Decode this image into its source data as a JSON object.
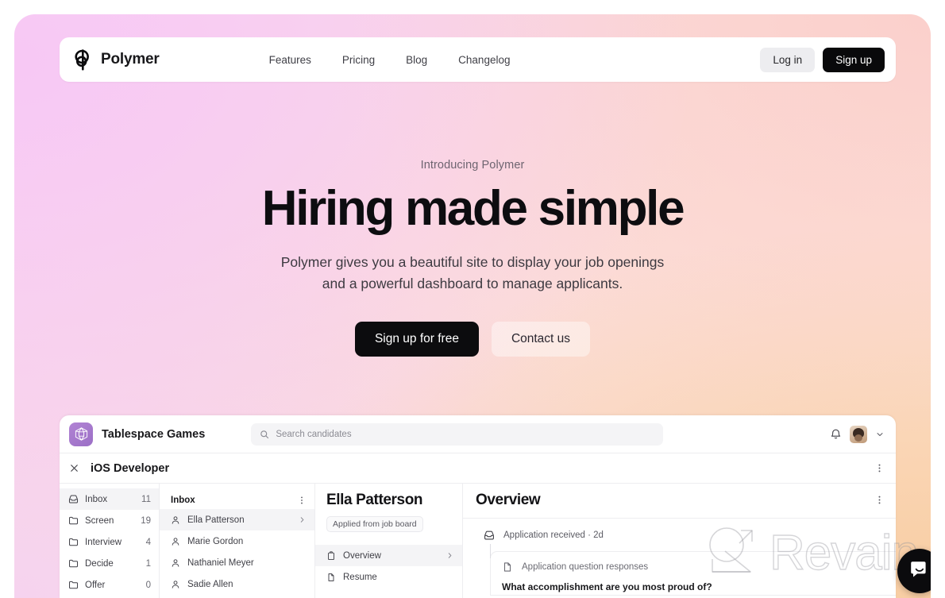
{
  "brand": {
    "name": "Polymer",
    "logo_icon": "polymer-logo-icon"
  },
  "nav": {
    "links": [
      {
        "label": "Features"
      },
      {
        "label": "Pricing"
      },
      {
        "label": "Blog"
      },
      {
        "label": "Changelog"
      }
    ],
    "login_label": "Log in",
    "signup_label": "Sign up"
  },
  "hero": {
    "eyebrow": "Introducing Polymer",
    "headline": "Hiring made simple",
    "subhead_line1": "Polymer gives you a beautiful site to display your job openings",
    "subhead_line2": "and a powerful dashboard to manage applicants.",
    "cta_primary": "Sign up for free",
    "cta_secondary": "Contact us"
  },
  "app": {
    "org_name": "Tablespace Games",
    "org_logo_icon": "d20-dice-icon",
    "search": {
      "placeholder": "Search candidates",
      "value": "",
      "icon": "search-icon"
    },
    "notifications_icon": "bell-icon",
    "avatar_icon": "user-avatar",
    "account_chevron_icon": "chevron-down-icon",
    "job": {
      "close_icon": "close-icon",
      "title": "iOS Developer",
      "menu_icon": "kebab-menu-icon"
    },
    "stages": [
      {
        "label": "Inbox",
        "count": "11",
        "icon": "inbox-tray-icon",
        "active": true
      },
      {
        "label": "Screen",
        "count": "19",
        "icon": "folder-icon",
        "active": false
      },
      {
        "label": "Interview",
        "count": "4",
        "icon": "folder-icon",
        "active": false
      },
      {
        "label": "Decide",
        "count": "1",
        "icon": "folder-icon",
        "active": false
      },
      {
        "label": "Offer",
        "count": "0",
        "icon": "folder-icon",
        "active": false
      }
    ],
    "candidate_list": {
      "header": "Inbox",
      "menu_icon": "kebab-menu-icon",
      "items": [
        {
          "name": "Ella Patterson",
          "icon": "person-icon",
          "active": true
        },
        {
          "name": "Marie Gordon",
          "icon": "person-icon",
          "active": false
        },
        {
          "name": "Nathaniel Meyer",
          "icon": "person-icon",
          "active": false
        },
        {
          "name": "Sadie Allen",
          "icon": "person-icon",
          "active": false
        }
      ]
    },
    "candidate_detail": {
      "name": "Ella Patterson",
      "source_badge": "Applied from job board",
      "sections": [
        {
          "label": "Overview",
          "icon": "clipboard-icon",
          "active": true
        },
        {
          "label": "Resume",
          "icon": "document-icon",
          "active": false
        }
      ]
    },
    "overview": {
      "title": "Overview",
      "menu_icon": "kebab-menu-icon",
      "timeline_event": "Application received · 2d",
      "timeline_event_icon": "inbox-tray-icon",
      "card_label": "Application question responses",
      "card_icon": "document-icon",
      "question": "What accomplishment are you most proud of?"
    }
  },
  "watermark": {
    "text": "Revain",
    "logo_icon": "revain-logo-icon"
  },
  "chat_widget": {
    "icon": "chat-bubble-icon",
    "label": ""
  },
  "colors": {
    "accent_dark": "#09090b",
    "brand_purple": "#9b6fc6",
    "gradient_top_left": "#f8d6f6",
    "gradient_top_right": "#fbdcdb",
    "gradient_bottom_right": "#fde2cd"
  }
}
